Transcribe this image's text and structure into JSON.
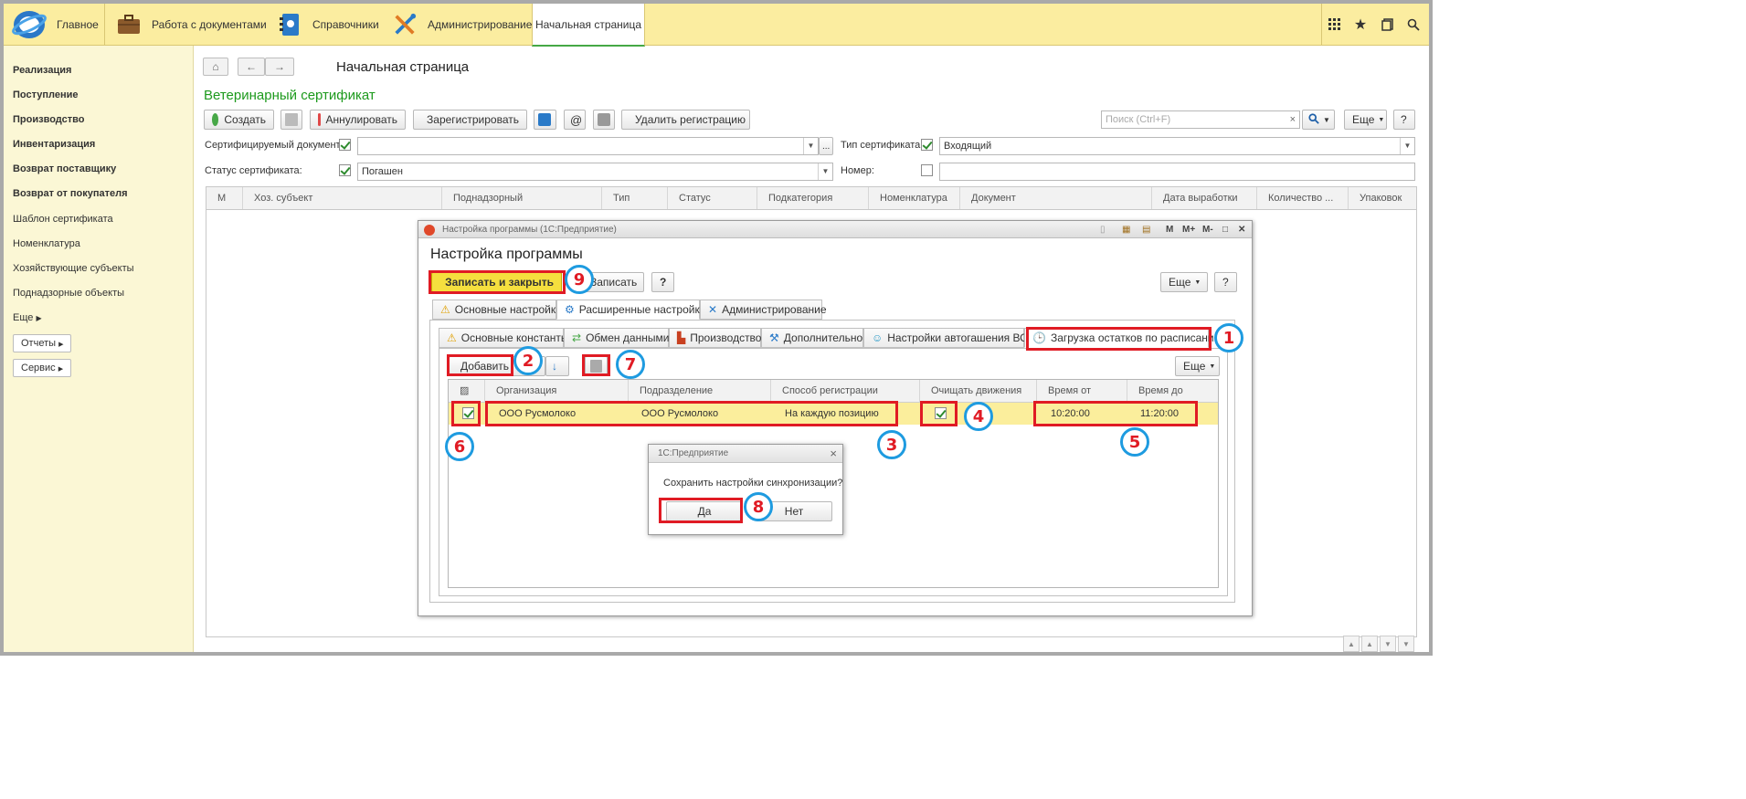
{
  "topbar": {
    "items": [
      {
        "label": "Главное",
        "icon": "logo-1c-icon"
      },
      {
        "label": "Работа с документами",
        "icon": "briefcase-icon"
      },
      {
        "label": "Справочники",
        "icon": "phonebook-icon"
      },
      {
        "label": "Администрирование",
        "icon": "tools-icon"
      }
    ],
    "active_tab": "Начальная страница",
    "right_icons": [
      "apps-grid-icon",
      "star-icon",
      "history-icon",
      "search-icon"
    ]
  },
  "sidebar": {
    "bold_items": [
      "Реализация",
      "Поступление",
      "Производство",
      "Инвентаризация",
      "Возврат поставщику",
      "Возврат от покупателя"
    ],
    "items": [
      "Шаблон сертификата",
      "Номенклатура",
      "Хозяйствующие субъекты",
      "Поднадзорные объекты"
    ],
    "more": "Еще",
    "buttons": [
      "Отчеты",
      "Сервис"
    ]
  },
  "page": {
    "title": "Начальная страница",
    "subtitle": "Ветеринарный сертификат"
  },
  "toolbar": {
    "create": "Создать",
    "cancel": "Аннулировать",
    "register": "Зарегистрировать",
    "at": "@",
    "delete_reg": "Удалить регистрацию",
    "search_placeholder": "Поиск (Ctrl+F)",
    "clear": "×",
    "more": "Еще",
    "help": "?"
  },
  "filters": {
    "cert_doc_label": "Сертифицируемый документ:",
    "cert_type_label": "Тип сертификата:",
    "cert_type_value": "Входящий",
    "status_label": "Статус сертификата:",
    "status_value": "Погашен",
    "number_label": "Номер:",
    "ellipsis": "..."
  },
  "grid": {
    "columns": [
      "М",
      "Хоз. субъект",
      "Поднадзорный",
      "Тип",
      "Статус",
      "Подкатегория",
      "Номенклатура",
      "Документ",
      "Дата выработки",
      "Количество ...",
      "Упаковок"
    ]
  },
  "dialog": {
    "window_title": "Настройка программы  (1С:Предприятие)",
    "window_icons": [
      "M",
      "M+",
      "M-"
    ],
    "heading": "Настройка программы",
    "save_close": "Записать и закрыть",
    "save": "Записать",
    "help": "?",
    "more": "Еще",
    "tabs": [
      "Основные настройки",
      "Расширенные настройки",
      "Администрирование"
    ],
    "subtabs": [
      "Основные константы",
      "Обмен данными",
      "Производство",
      "Дополнительно",
      "Настройки автогашения ВСД",
      "Загрузка остатков по расписанию"
    ],
    "add": "Добавить",
    "inner_columns": [
      "Организация",
      "Подразделение",
      "Способ регистрации",
      "Очищать движения",
      "Время от",
      "Время до"
    ],
    "row": {
      "org": "ООО Русмолоко",
      "division": "ООО Русмолоко",
      "method": "На каждую позицию",
      "time_from": "10:20:00",
      "time_to": "11:20:00",
      "enabled": true,
      "clear_moves": true
    }
  },
  "popup": {
    "title": "1С:Предприятие",
    "question": "Сохранить настройки синхронизации?",
    "yes": "Да",
    "no": "Нет",
    "close": "×"
  },
  "annotations": [
    "1",
    "2",
    "3",
    "4",
    "5",
    "6",
    "7",
    "8",
    "9"
  ],
  "colors": {
    "topbar_bg": "#fbeda0",
    "sidebar_bg": "#fbf7d5",
    "accent_green": "#45a845",
    "annotation_red": "#e01b24",
    "annotation_blue": "#1e9be0",
    "selected_row": "#fbee9c"
  }
}
